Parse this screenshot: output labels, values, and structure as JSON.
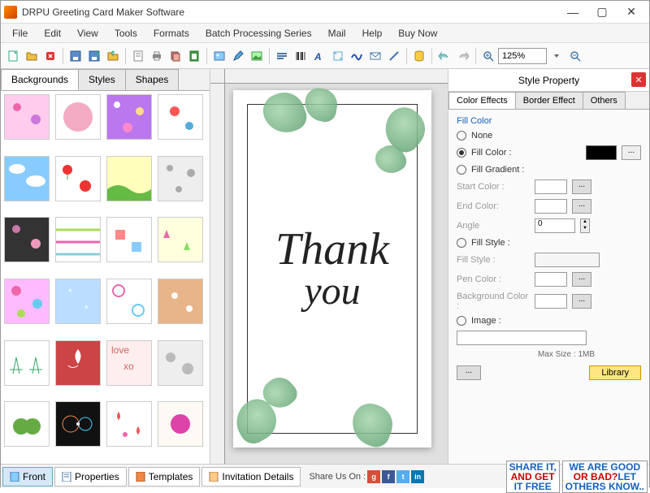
{
  "app": {
    "title": "DRPU Greeting Card Maker Software"
  },
  "menu": {
    "items": [
      "File",
      "Edit",
      "View",
      "Tools",
      "Formats",
      "Batch Processing Series",
      "Mail",
      "Help",
      "Buy Now"
    ]
  },
  "zoom": {
    "value": "125%"
  },
  "leftTabs": {
    "items": [
      "Backgrounds",
      "Styles",
      "Shapes"
    ],
    "active": 0
  },
  "card": {
    "line1": "Thank",
    "line2": "you"
  },
  "styleProperty": {
    "title": "Style Property",
    "tabs": [
      "Color Effects",
      "Border Effect",
      "Others"
    ],
    "activeTab": 0,
    "fillColor": {
      "groupLabel": "Fill Color",
      "none": "None",
      "fillColorLabel": "Fill Color :",
      "fillGradientLabel": "Fill Gradient :",
      "startColor": "Start Color :",
      "endColor": "End Color:",
      "angle": "Angle",
      "angleValue": "0",
      "fillStyleLabel": "Fill Style :",
      "fillStyleField": "Fill Style :",
      "penColor": "Pen Color :",
      "bgColor": "Background Color :",
      "imageLabel": "Image :",
      "maxSize": "Max Size : 1MB",
      "ellipsis": "...",
      "library": "Library"
    }
  },
  "bottomTabs": {
    "front": "Front",
    "properties": "Properties",
    "templates": "Templates",
    "invitation": "Invitation Details"
  },
  "share": {
    "label": "Share Us On :"
  },
  "promo1": {
    "l1": "SHARE IT,",
    "l2": "AND GET",
    "l3": "IT FREE"
  },
  "promo2": {
    "l1": "WE ARE GOOD",
    "l2": "OR BAD?",
    "l3": "LET",
    "l4": "OTHERS KNOW.."
  }
}
